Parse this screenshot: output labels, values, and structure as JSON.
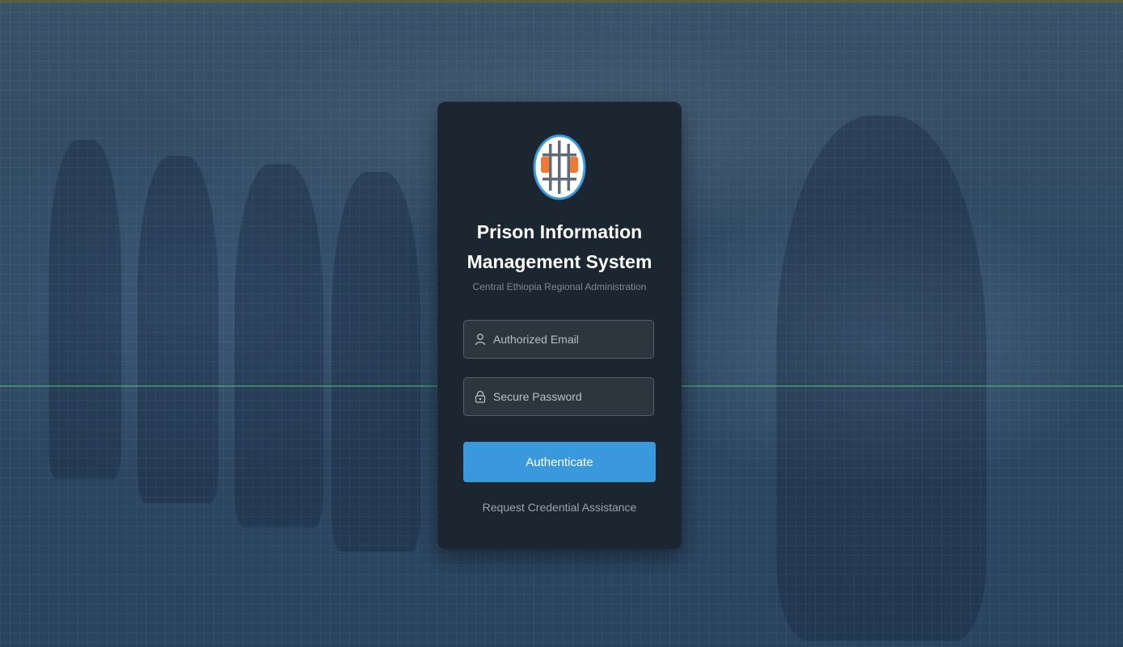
{
  "app": {
    "title_line1": "Prison Information",
    "title_line2": "Management System",
    "subtitle": "Central Ethiopia Regional Administration"
  },
  "login": {
    "email_placeholder": "Authorized Email",
    "email_value": "",
    "password_placeholder": "Secure Password",
    "password_value": "",
    "submit_label": "Authenticate",
    "help_link": "Request Credential Assistance"
  },
  "icons": {
    "logo": "prison-bars-logo-icon",
    "email": "user-icon",
    "password": "lock-icon"
  },
  "colors": {
    "card_background": "#1c2630",
    "button": "#3a98dc",
    "logo_ring": "#3a98dc",
    "logo_hands": "#ee7a33",
    "background_tint": "#2f4a62"
  }
}
